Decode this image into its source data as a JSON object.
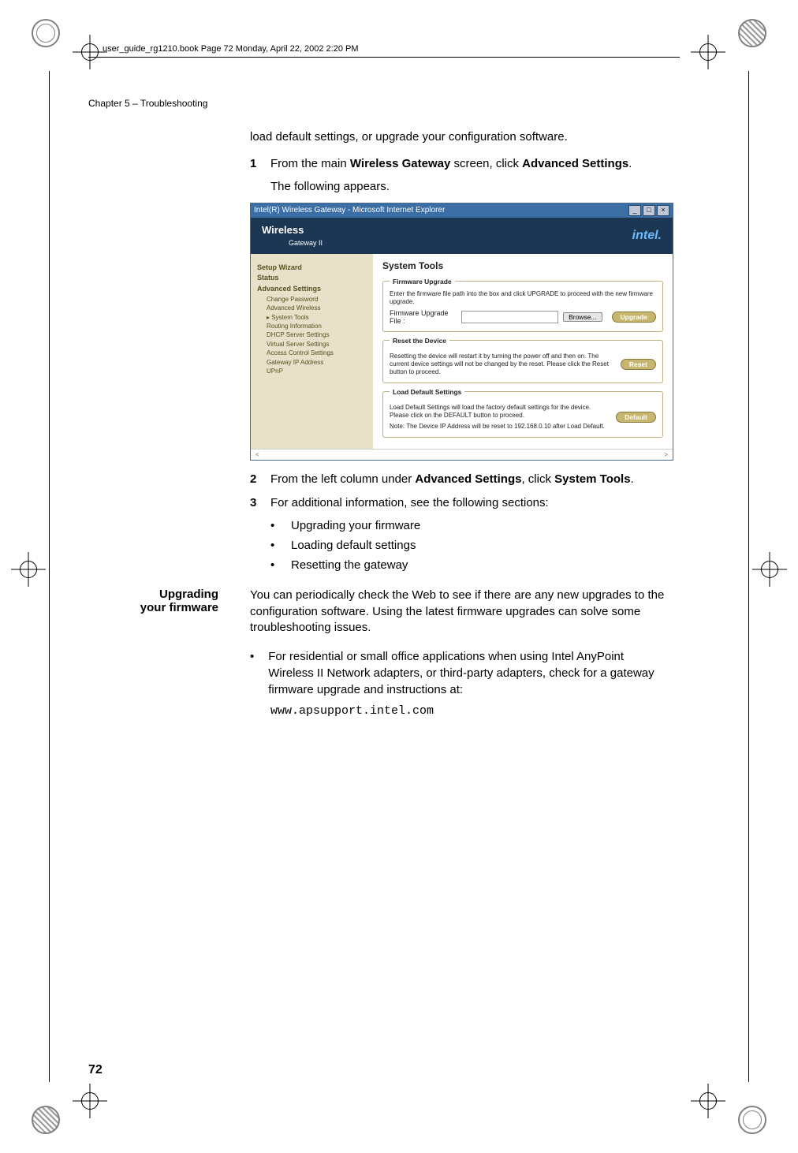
{
  "header": {
    "book_file": "user_guide_rg1210.book  Page 72  Monday, April 22, 2002  2:20 PM"
  },
  "chapter_title": "Chapter 5  –  Troubleshooting",
  "intro_para": "load default settings, or upgrade your configuration software.",
  "steps": {
    "s1": {
      "num": "1",
      "pre": "From the main ",
      "b1": "Wireless Gateway",
      "mid": " screen, click ",
      "b2": "Advanced Settings",
      "post": "."
    },
    "s1_sub": "The following appears.",
    "s2": {
      "num": "2",
      "pre": "From the left column under ",
      "b1": "Advanced Settings",
      "mid": ", click ",
      "b2": "System Tools",
      "post": "."
    },
    "s3": {
      "num": "3",
      "text": "For additional information, see the following sections:"
    }
  },
  "bullets": {
    "b1": "Upgrading your firmware",
    "b2": "Loading default settings",
    "b3": "Resetting the gateway"
  },
  "side_heading": {
    "l1": "Upgrading",
    "l2": "your firmware"
  },
  "upgrade_para": "You can periodically check the Web to see if there are any new upgrades to the configuration software. Using the latest firmware upgrades can solve some troubleshooting issues.",
  "big_bullet": "For residential or small office applications when using Intel AnyPoint Wireless II Network adapters, or third-party adapters, check for a gateway firmware upgrade and instructions at:",
  "url": "www.apsupport.intel.com",
  "page_num": "72",
  "shot": {
    "title": "Intel(R) Wireless Gateway - Microsoft Internet Explorer",
    "win_min": "_",
    "win_max": "□",
    "win_close": "×",
    "brand_line1": "Wireless",
    "brand_line2": "Gateway II",
    "intel": "intel.",
    "side": {
      "wizard": "Setup Wizard",
      "status": "Status",
      "adv": "Advanced Settings",
      "items": [
        "Change Password",
        "Advanced Wireless",
        "System Tools",
        "Routing Information",
        "DHCP Server Settings",
        "Virtual Server Settings",
        "Access Control Settings",
        "Gateway IP Address",
        "UPnP"
      ]
    },
    "panel": {
      "h": "System Tools",
      "fw": {
        "legend": "Firmware Upgrade",
        "p1": "Enter the firmware file path into the box and click UPGRADE to proceed with the new firmware upgrade.",
        "label": "Firmware Upgrade File :",
        "browse": "Browse...",
        "upgrade": "Upgrade"
      },
      "reset": {
        "legend": "Reset the Device",
        "p": "Resetting the device will restart it by turning the power off and then on. The current device settings will not be changed by the reset. Please click the Reset button to proceed.",
        "btn": "Reset"
      },
      "def": {
        "legend": "Load Default Settings",
        "p1": "Load Default Settings will load the factory default settings for the device. Please click on the DEFAULT button to proceed.",
        "p2": "Note: The Device IP Address will be reset to 192.168.0.10 after Load Default.",
        "btn": "Default"
      }
    }
  }
}
